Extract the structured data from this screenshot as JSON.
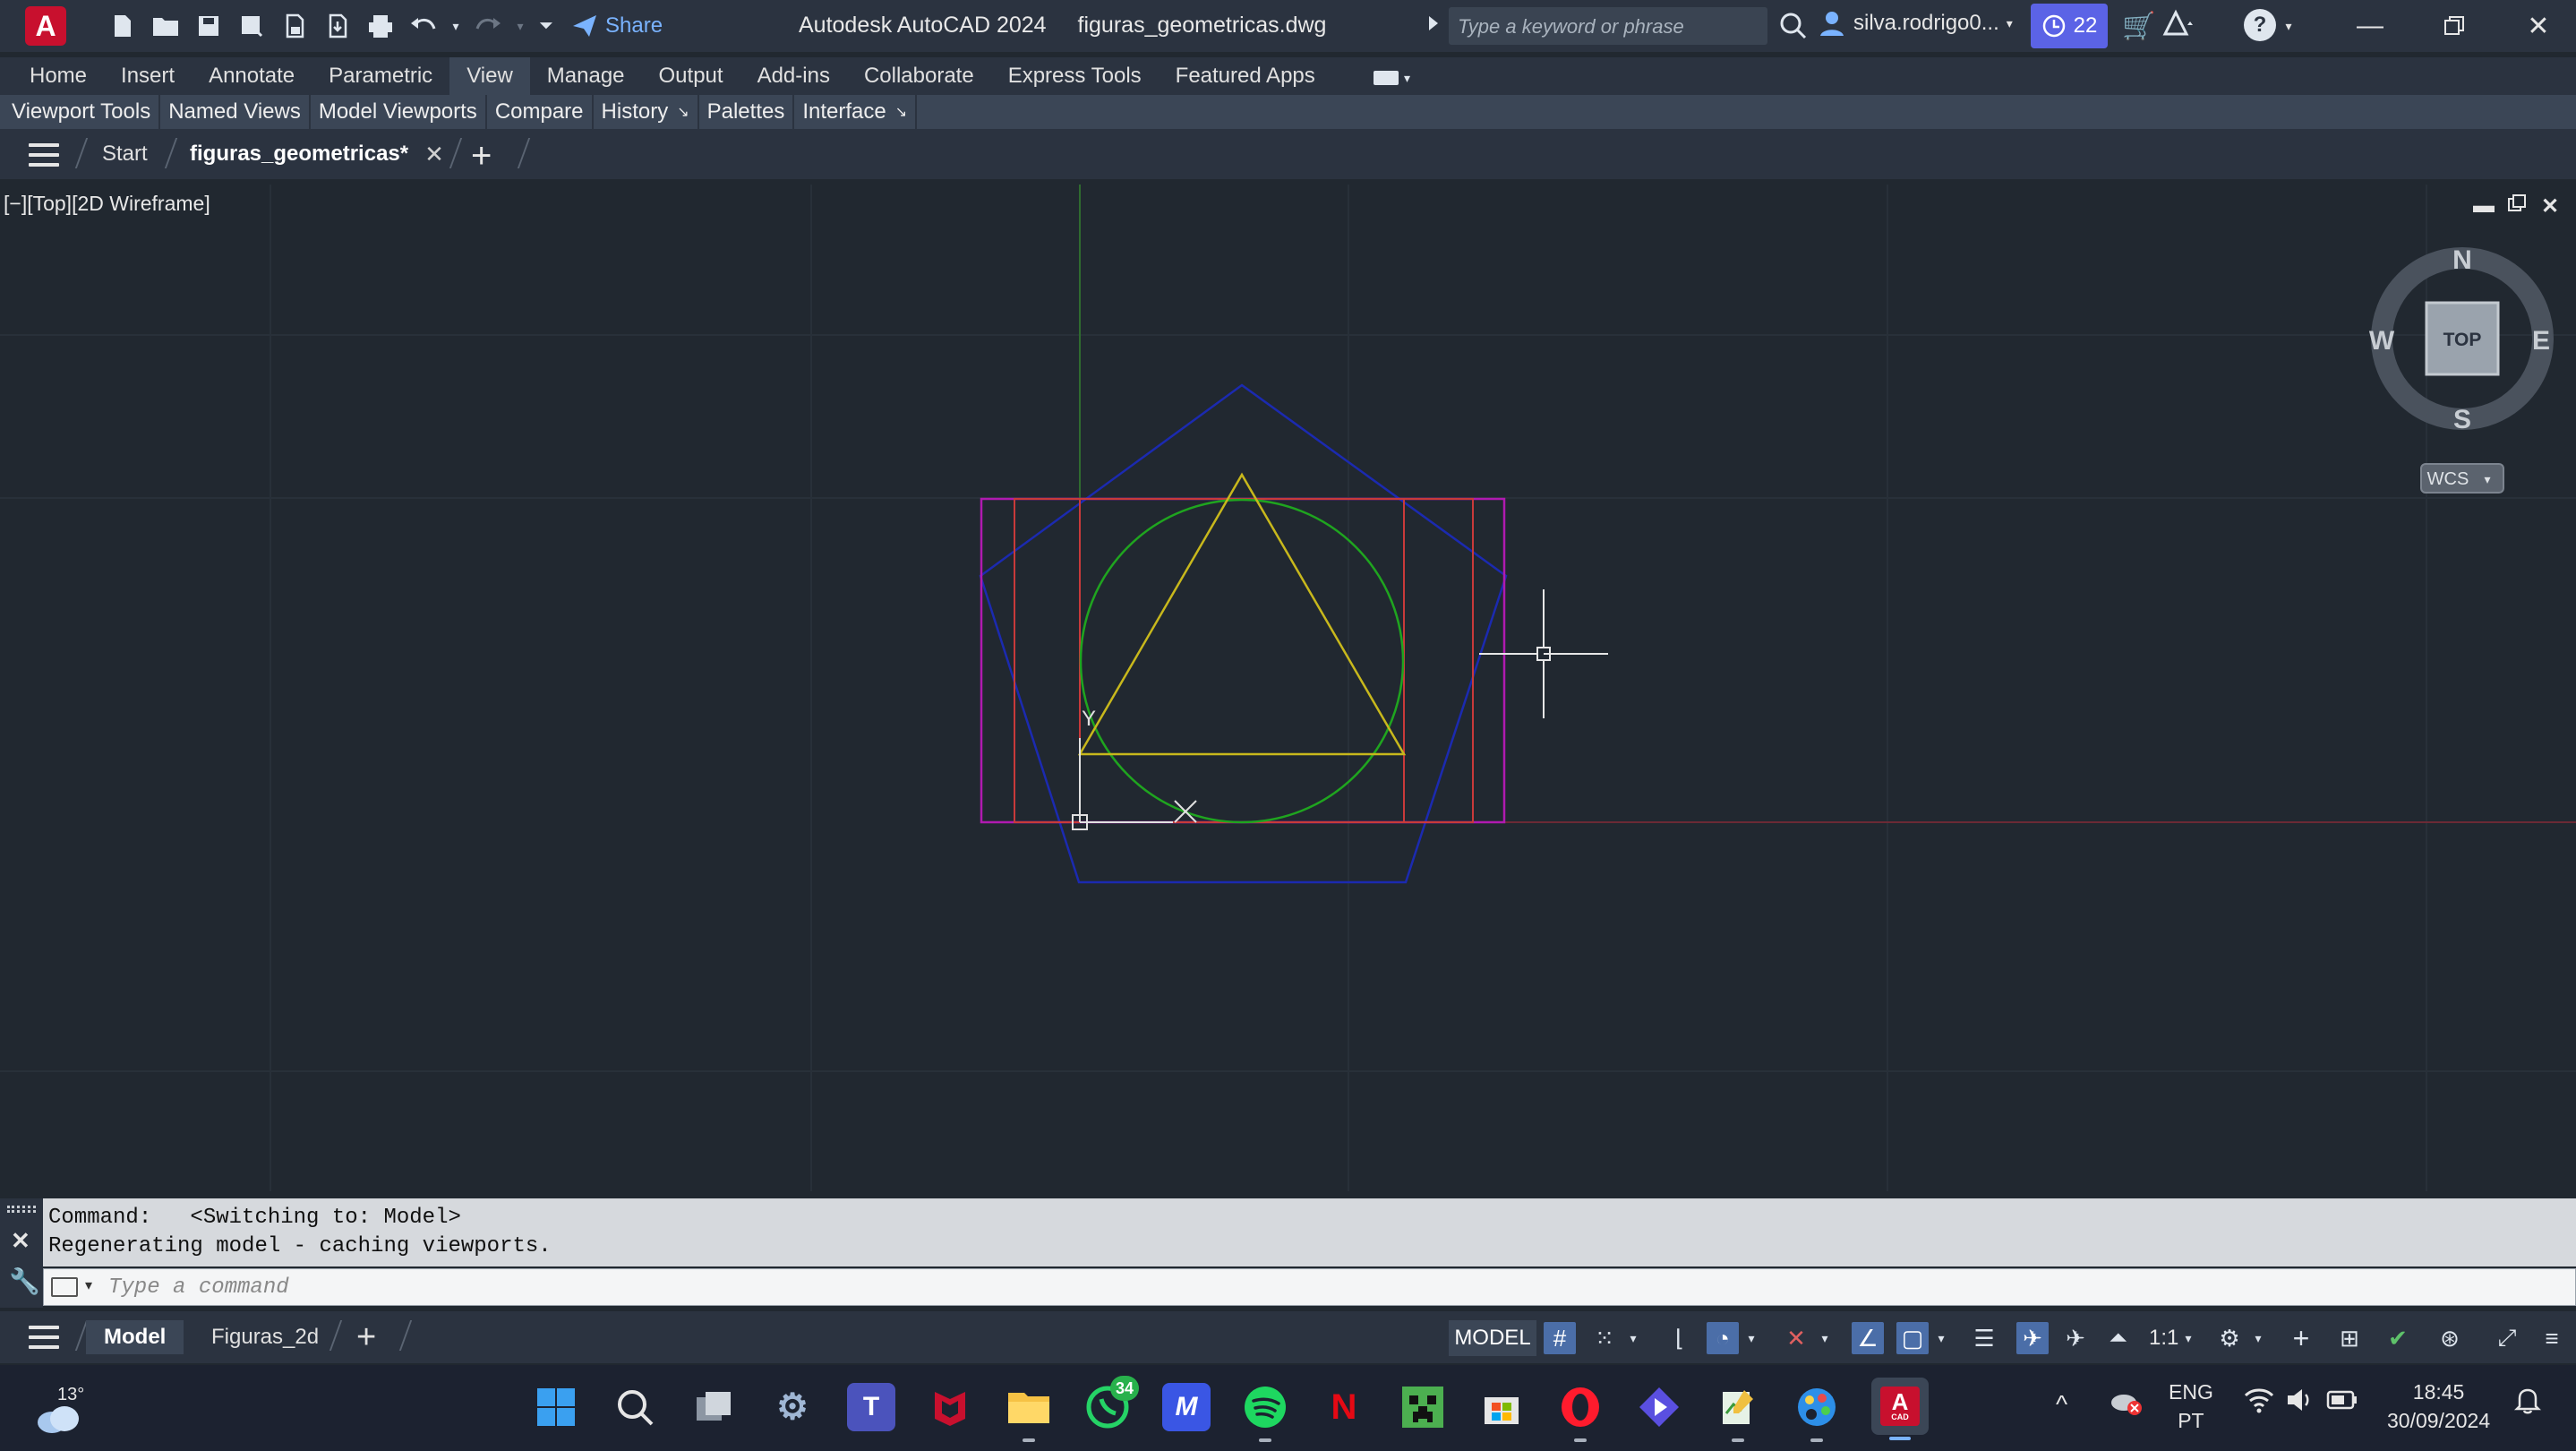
{
  "app": {
    "logo_letter": "A",
    "title": "Autodesk AutoCAD 2024",
    "file_name": "figuras_geometricas.dwg",
    "share_label": "Share",
    "search_placeholder": "Type a keyword or phrase",
    "user_name": "silva.rodrigo0...",
    "trial_days": "22"
  },
  "ribbon": {
    "tabs": [
      "Home",
      "Insert",
      "Annotate",
      "Parametric",
      "View",
      "Manage",
      "Output",
      "Add-ins",
      "Collaborate",
      "Express Tools",
      "Featured Apps"
    ],
    "active_tab": "View",
    "panels": [
      "Viewport Tools",
      "Named Views",
      "Model Viewports",
      "Compare",
      "History",
      "Palettes",
      "Interface"
    ]
  },
  "file_tabs": {
    "start_label": "Start",
    "active_file": "figuras_geometricas*"
  },
  "viewport": {
    "label": "[−][Top][2D Wireframe]",
    "viewcube": {
      "top_label": "TOP",
      "north": "N",
      "south": "S",
      "east": "E",
      "west": "W"
    },
    "ucs_menu": "WCS",
    "ucs_y": "Y"
  },
  "command": {
    "history": [
      "Command:   <Switching to: Model>",
      "Regenerating model - caching viewports."
    ],
    "placeholder": "Type a command"
  },
  "layout_tabs": [
    "Model",
    "Figuras_2d"
  ],
  "status": {
    "space": "MODEL",
    "annotation_scale": "1:1"
  },
  "taskbar": {
    "temperature": "13°",
    "whatsapp_badge": "34",
    "language_top": "ENG",
    "language_bottom": "PT",
    "time": "18:45",
    "date": "30/09/2024",
    "autocad_tile": "CAD"
  },
  "colors": {
    "accent_blue": "#4b6ea8",
    "trial_purple": "#5b63e6",
    "pentagon": "#1b2ab0",
    "rectangle_outer": "#b01ab0",
    "rectangle_inner": "#c83a3a",
    "circle": "#1fa51f",
    "triangle": "#c8b81c"
  }
}
